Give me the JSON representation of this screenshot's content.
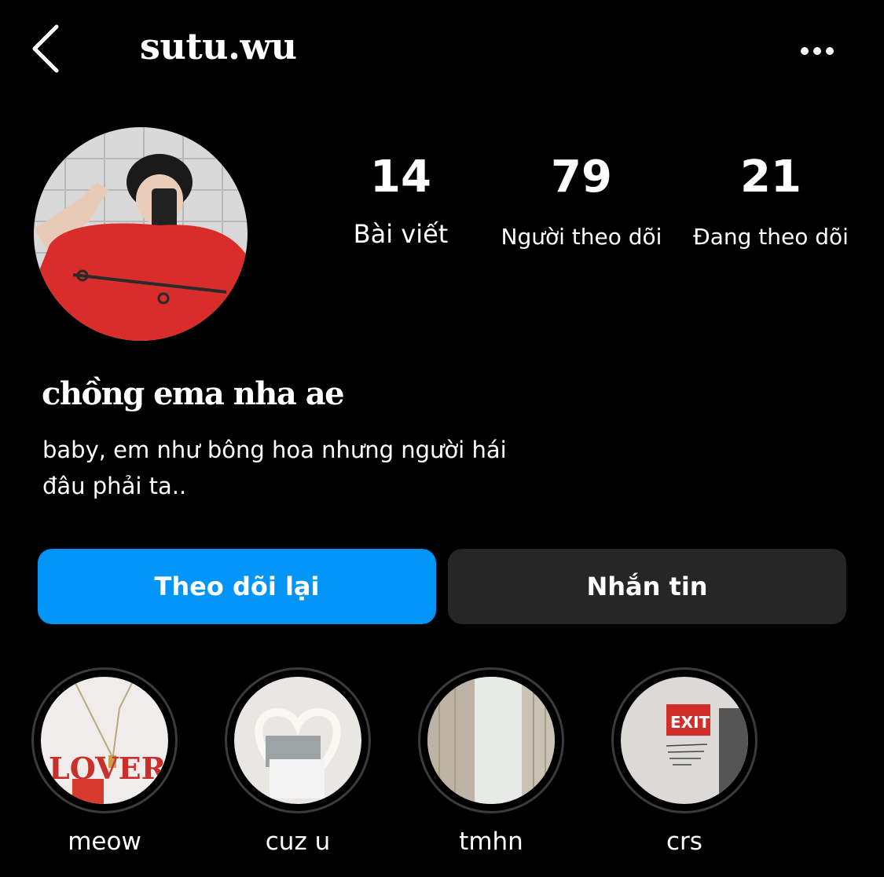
{
  "header": {
    "username": "sutu.wu",
    "back_icon": "chevron-left-icon",
    "more_icon": "more-horizontal-icon"
  },
  "profile": {
    "avatar_icon": "avatar",
    "display_name": "chồng ema nha ae",
    "bio_line1": "baby, em như bông hoa nhưng người hái",
    "bio_line2": "đâu phải ta.."
  },
  "stats": {
    "posts": {
      "value": "14",
      "label": "Bài viết"
    },
    "followers": {
      "value": "79",
      "label": "Người theo dõi"
    },
    "following": {
      "value": "21",
      "label": "Đang theo dõi"
    }
  },
  "actions": {
    "follow_back": "Theo dõi lại",
    "message": "Nhắn tin",
    "accent_color": "#0095f6"
  },
  "highlights": [
    {
      "label": "meow"
    },
    {
      "label": "cuz u"
    },
    {
      "label": "tmhn"
    },
    {
      "label": "crs"
    }
  ]
}
